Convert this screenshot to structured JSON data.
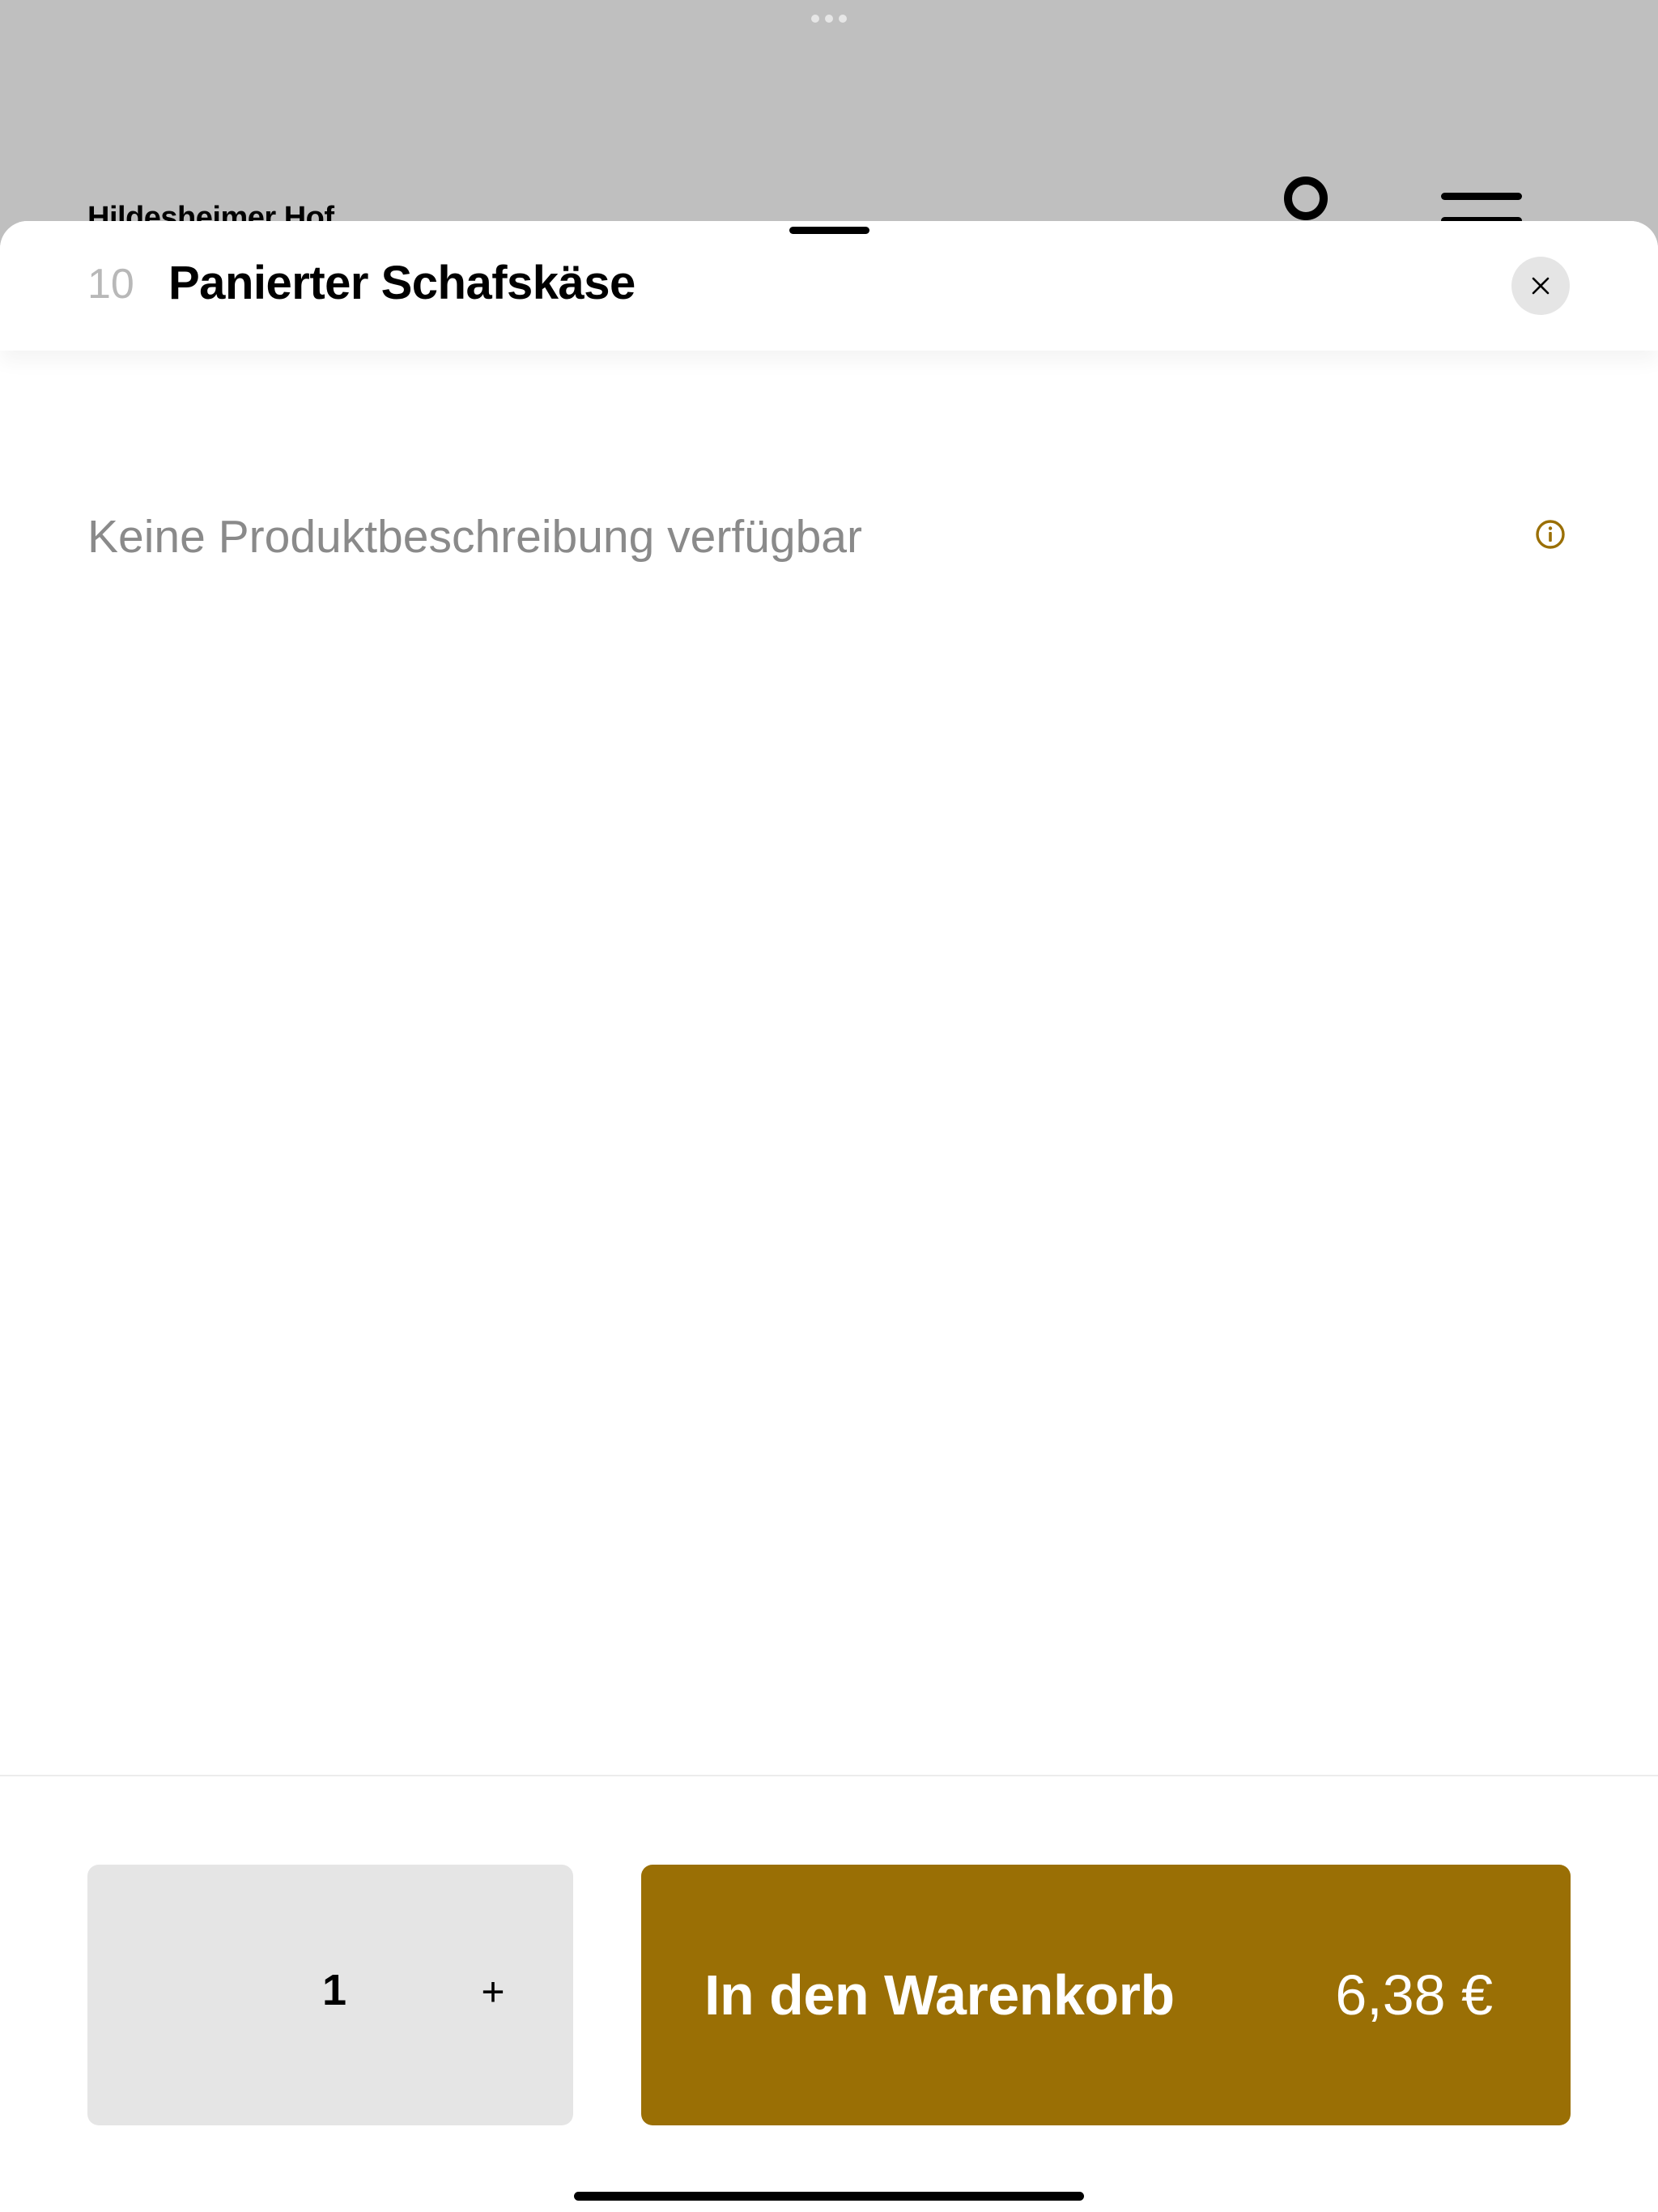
{
  "background": {
    "restaurant_name": "Hildesheimer Hof",
    "icons": [
      "more-dots-icon",
      "search-icon",
      "menu-icon"
    ]
  },
  "product": {
    "number": "10",
    "title": "Panierter Schafskäse",
    "description": "Keine Produktbeschreibung verfügbar"
  },
  "quantity": {
    "value": "1",
    "increment_label": "+"
  },
  "cart_button": {
    "label": "In den Warenkorb",
    "price": "6,38 €"
  },
  "colors": {
    "accent": "#9a6f05",
    "overlay": "#bfbfbf",
    "muted_text": "#8a8a8a",
    "number_text": "#b8b8b8",
    "quantity_bg": "#e5e5e5"
  }
}
